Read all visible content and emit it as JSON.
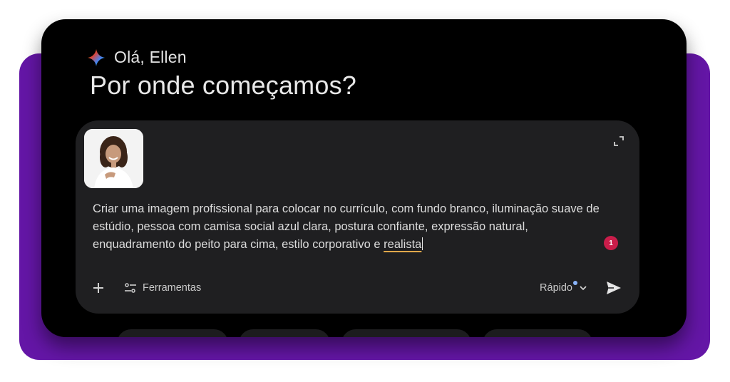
{
  "greeting": {
    "text": "Olá, Ellen",
    "icon": "gemini-sparkle-icon"
  },
  "headline": "Por onde começamos?",
  "composer": {
    "attachment": {
      "kind": "image",
      "description": "retrato-mulher-cabelo-cacheado",
      "icon": "image-thumbnail"
    },
    "prompt_text": "Criar uma imagem profissional para colocar no currículo, com fundo branco, iluminação suave de estúdio, pessoa com camisa social azul clara, postura confiante, expressão natural, enquadramento do peito para cima, estilo corporativo e",
    "prompt_flagged_word": "realista",
    "spellcheck_badge": "1",
    "toolbar": {
      "add_icon": "plus-icon",
      "tools_icon": "tune-icon",
      "tools_label": "Ferramentas",
      "mode_label": "Rápido",
      "mode_icon": "chevron-down-icon",
      "send_icon": "send-icon",
      "expand_icon": "expand-icon"
    }
  },
  "colors": {
    "background_slab": "#6416a6",
    "window": "#000000",
    "composer": "#1f1f21",
    "badge": "#c91d4a",
    "underline": "#e0a84a",
    "mode_dot": "#8ab4f8"
  }
}
